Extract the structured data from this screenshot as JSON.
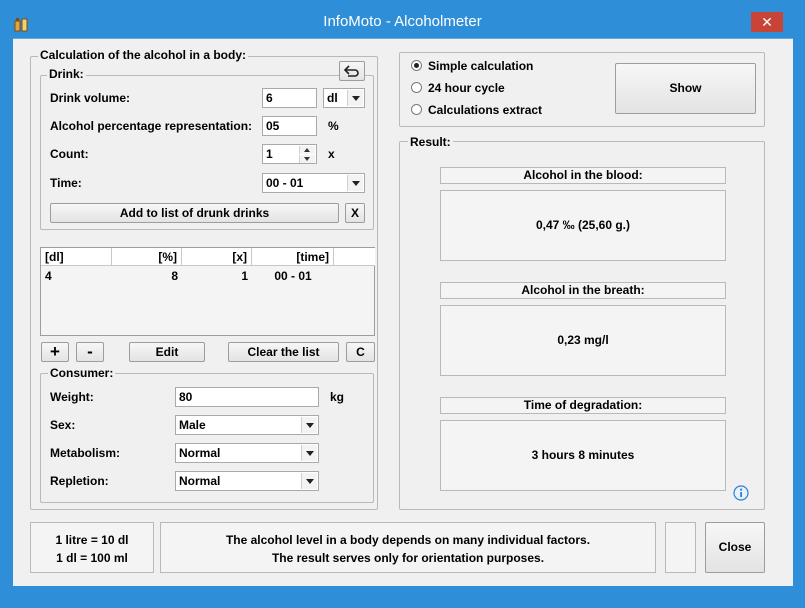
{
  "window": {
    "title": "InfoMoto - Alcoholmeter",
    "close_symbol": "✕"
  },
  "calc_group": {
    "legend": "Calculation of the alcohol in a body:"
  },
  "drink": {
    "legend": "Drink:",
    "volume_label": "Drink volume:",
    "volume_value": "6",
    "volume_unit": "dl",
    "percentage_label": "Alcohol percentage representation:",
    "percentage_value": "05",
    "percentage_unit": "%",
    "count_label": "Count:",
    "count_value": "1",
    "count_unit": "x",
    "time_label": "Time:",
    "time_value": "00 - 01",
    "add_button": "Add to list of drunk drinks",
    "clear_x_button": "X"
  },
  "drinks_list": {
    "columns": [
      "[dl]",
      "[%]",
      "[x]",
      "[time]"
    ],
    "rows": [
      [
        "4",
        "8",
        "1",
        "00 - 01"
      ]
    ]
  },
  "list_buttons": {
    "plus": "+",
    "minus": "-",
    "edit": "Edit",
    "clear": "Clear the list",
    "c": "C"
  },
  "consumer": {
    "legend": "Consumer:",
    "weight_label": "Weight:",
    "weight_value": "80",
    "weight_unit": "kg",
    "sex_label": "Sex:",
    "sex_value": "Male",
    "metabolism_label": "Metabolism:",
    "metabolism_value": "Normal",
    "repletion_label": "Repletion:",
    "repletion_value": "Normal"
  },
  "mode": {
    "options": [
      "Simple calculation",
      "24 hour cycle",
      "Calculations extract"
    ],
    "selected": 0,
    "show_button": "Show"
  },
  "result": {
    "legend": "Result:",
    "blood_head": "Alcohol in the blood:",
    "blood_value": "0,47 ‰  (25,60 g.)",
    "breath_head": "Alcohol in the breath:",
    "breath_value": "0,23 mg/l",
    "degradation_head": "Time of degradation:",
    "degradation_value": "3 hours 8 minutes"
  },
  "footer": {
    "conv1": "1 litre = 10 dl",
    "conv2": "1 dl = 100 ml",
    "note1": "The alcohol level in a body depends on many individual factors.",
    "note2": "The result serves only for orientation purposes.",
    "close_button": "Close"
  },
  "colors": {
    "titlebar": "#2e8fd8",
    "close": "#c84436",
    "panel": "#f0f0f0"
  },
  "icons": {
    "app": "bottle-icon",
    "undo": "undo-arrow-icon",
    "info": "info-icon"
  }
}
